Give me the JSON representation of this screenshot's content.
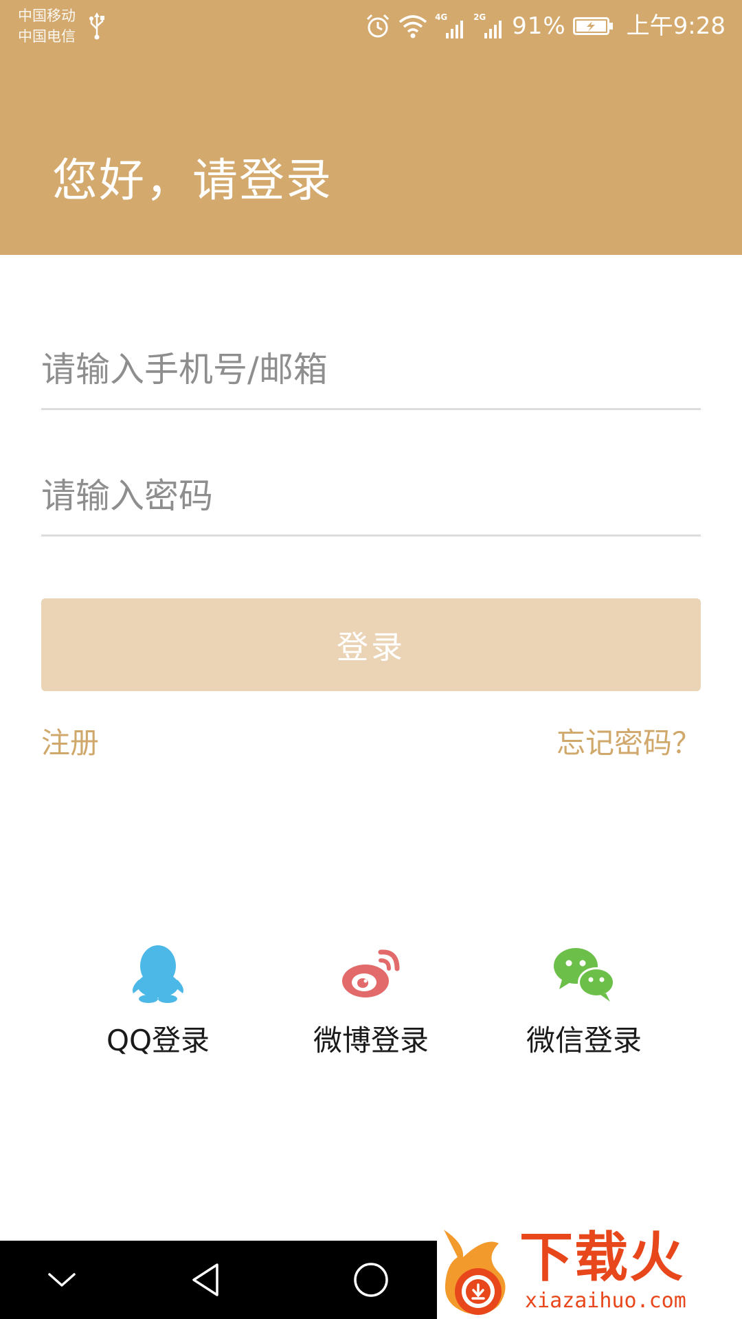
{
  "status_bar": {
    "carrier_1": "中国移动",
    "carrier_2": "中国电信",
    "network_1": "4G",
    "network_2": "2G",
    "battery_percent": "91%",
    "time": "上午9:28",
    "icons": [
      "usb-icon",
      "alarm-icon",
      "wifi-icon",
      "signal-icon",
      "signal-icon",
      "battery-charging-icon"
    ]
  },
  "header": {
    "greeting": "您好，请登录",
    "background_color": "#d3a96d"
  },
  "form": {
    "account_placeholder": "请输入手机号/邮箱",
    "account_value": "",
    "password_placeholder": "请输入密码",
    "password_value": "",
    "login_label": "登录",
    "login_button_color": "#ead4b5",
    "register_label": "注册",
    "forgot_label": "忘记密码？",
    "link_color": "#d0a86b"
  },
  "social_login": [
    {
      "label": "QQ登录",
      "icon": "qq-penguin-icon",
      "color": "#4cb8e8"
    },
    {
      "label": "微博登录",
      "icon": "weibo-icon",
      "color": "#e26a6a"
    },
    {
      "label": "微信登录",
      "icon": "wechat-icon",
      "color": "#6cc04a"
    }
  ],
  "nav_bar": {
    "icons": [
      "hide-keyboard-icon",
      "back-icon",
      "home-icon"
    ]
  },
  "watermark": {
    "logo_text": "下载火",
    "url": "xiazaihuo.com"
  }
}
